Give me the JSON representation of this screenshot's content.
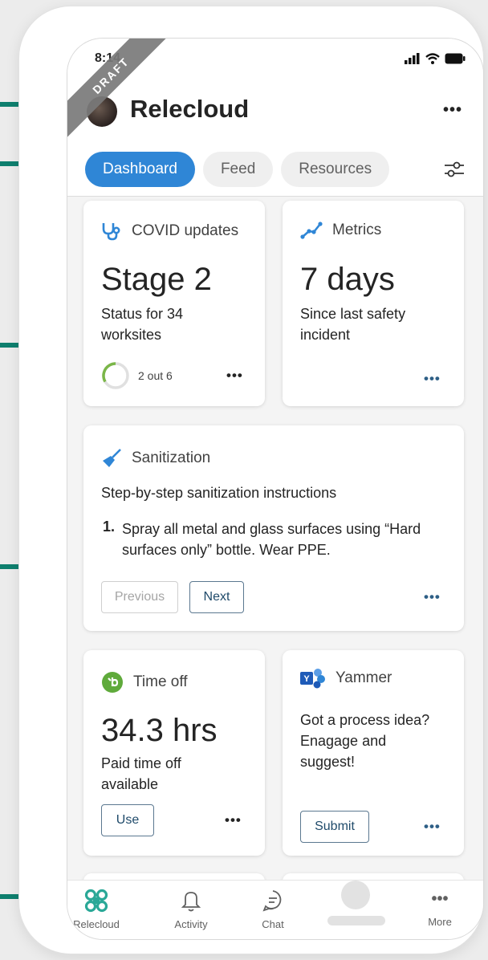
{
  "status": {
    "time": "8:14"
  },
  "ribbon": {
    "label": "DRAFT"
  },
  "header": {
    "title": "Relecloud",
    "more": "•••"
  },
  "tabs": [
    {
      "label": "Dashboard"
    },
    {
      "label": "Feed"
    },
    {
      "label": "Resources"
    }
  ],
  "cards": {
    "covid": {
      "title": "COVID updates",
      "value": "Stage 2",
      "subtitle": "Status for 34 worksites",
      "progress_label": "2 out 6",
      "progress": 0.3333,
      "more": "•••"
    },
    "metrics": {
      "title": "Metrics",
      "value": "7 days",
      "subtitle": "Since last safety incident",
      "more": "•••"
    },
    "sanitization": {
      "title": "Sanitization",
      "heading": "Step-by-step sanitization instructions",
      "step_number": "1.",
      "step_text": "Spray all metal and glass surfaces using “Hard surfaces only” bottle. Wear PPE.",
      "prev_label": "Previous",
      "next_label": "Next",
      "more": "•••"
    },
    "timeoff": {
      "title": "Time off",
      "value": "34.3 hrs",
      "subtitle": "Paid time off available",
      "button_label": "Use",
      "more": "•••"
    },
    "yammer": {
      "title": "Yammer",
      "subtitle": "Got a process idea? Enagage and suggest!",
      "button_label": "Submit",
      "more": "•••"
    }
  },
  "nav": [
    {
      "label": "Relecloud"
    },
    {
      "label": "Activity"
    },
    {
      "label": "Chat"
    },
    {
      "label": "More"
    }
  ],
  "colors": {
    "accent": "#2f86d6",
    "arrow": "#0e7f6e",
    "progress": "#7ab648",
    "timeoff": "#5faa3b"
  }
}
